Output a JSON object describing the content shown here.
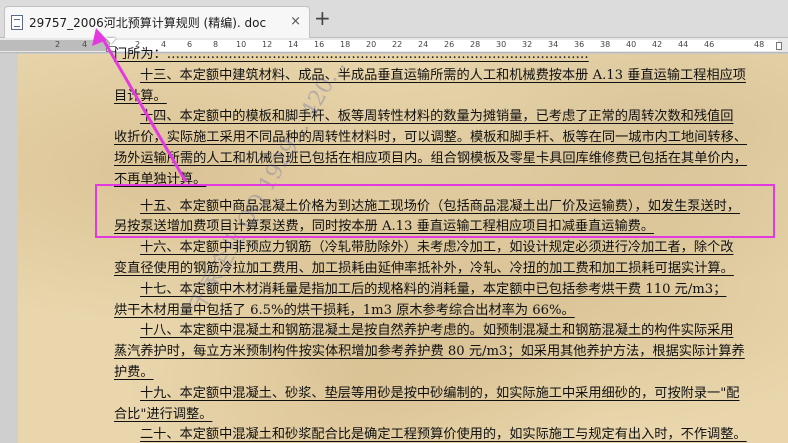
{
  "tab": {
    "title": "29757_2006河北预算计算规则 (精编). doc",
    "close_glyph": "×",
    "new_tab_glyph": "+"
  },
  "ruler": {
    "ticks": [
      "4",
      "2",
      "2",
      "4",
      "6",
      "8",
      "10",
      "12",
      "14",
      "16",
      "18",
      "20",
      "22",
      "24",
      "26",
      "28",
      "30",
      "32",
      "34",
      "36",
      "38",
      "40",
      "42",
      "44",
      "46",
      "48"
    ]
  },
  "document": {
    "lines": [
      "门所为：……………………………………………………………………………………",
      "十三、本定额中建筑材料、成品、半成品垂直运输所需的人工和机械费按本册 A.13 垂直运输工程相应项",
      "目计算。",
      "十四、本定额中的模板和脚手杆、板等周转性材料的数量为摊销量，已考虑了正常的周转次数和残值回",
      "收折价，实际施工采用不同品种的周转性材料时，可以调整。模板和脚手杆、板等在同一城市内工地间转移、",
      "场外运输所需的人工和机械台班已包括在相应项目内。组合钢模板及零星卡具回库维修费已包括在其单价内，",
      "不再单独计算。",
      "十五、本定额中商品混凝土价格为到达施工现场价（包括商品混凝土出厂价及运输费），如发生泵送时，",
      "另按泵送增加费项目计算泵送费，同时按本册 A.13 垂直运输工程相应项目扣减垂直运输费。",
      "十六、本定额中非预应力钢筋（冷轧带肋除外）未考虑冷加工，如设计规定必须进行冷加工者，除个改",
      "变直径使用的钢筋冷拉加工费用、加工损耗由延伸率抵补外，冷轧、冷扭的加工费和加工损耗可据实计算。",
      "十七、本定额中木材消耗量是指加工后的规格料的消耗量，本定额中已包括参考烘干费 110 元/m3；",
      "烘干木材用量中包括了 6.5%的烘干损耗，1m3 原木参考综合出材率为 66%。",
      "十八、本定额中混凝土和钢筋混凝土是按自然养护考虑的。如预制混凝土和钢筋混凝土的构件实际采用",
      "蒸汽养护时，每立方米预制构件按实体积增加参考养护费 80 元/m3；如采用其他养护方法，根据实际计算养",
      "护费。",
      "十九、本定额中混凝土、砂浆、垫层等用砂是按中砂编制的，如实际施工中采用细砂的，可按附录一\"配",
      "合比\"进行调整。",
      "二十、本定额中混凝土和砂浆配合比是确定工程预算价使用的，如实际施工与规定有出入时，不作调整。"
    ]
  },
  "watermark": {
    "text": "千家企业 QQ 1929… 420…"
  },
  "colors": {
    "annotation": "#e23ae0",
    "page_background": "#e9d6ac"
  }
}
